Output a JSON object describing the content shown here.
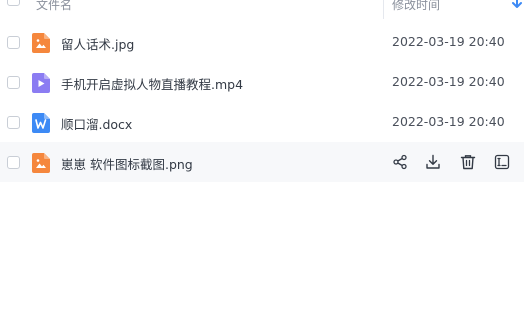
{
  "header": {
    "name_label": "文件名",
    "time_label": "修改时间",
    "sort_icon": "sort-down-icon"
  },
  "files": [
    {
      "name": "留人话术.jpg",
      "time": "2022-03-19 20:40",
      "icon": "image-file-icon",
      "color": "#f5873d"
    },
    {
      "name": "手机开启虚拟人物直播教程.mp4",
      "time": "2022-03-19 20:40",
      "icon": "video-file-icon",
      "color": "#8b7cf2"
    },
    {
      "name": "顺口溜.docx",
      "time": "2022-03-19 20:40",
      "icon": "word-file-icon",
      "color": "#3d8af5"
    },
    {
      "name": "崽崽 软件图标截图.png",
      "icon": "image-file-icon",
      "color": "#f5873d"
    }
  ],
  "row_actions": [
    "share-icon",
    "download-icon",
    "delete-icon",
    "rename-icon"
  ],
  "colors": {
    "accent": "#3d8af5",
    "hover_row": "#f7f8fa",
    "action_icon": "#333a45"
  }
}
